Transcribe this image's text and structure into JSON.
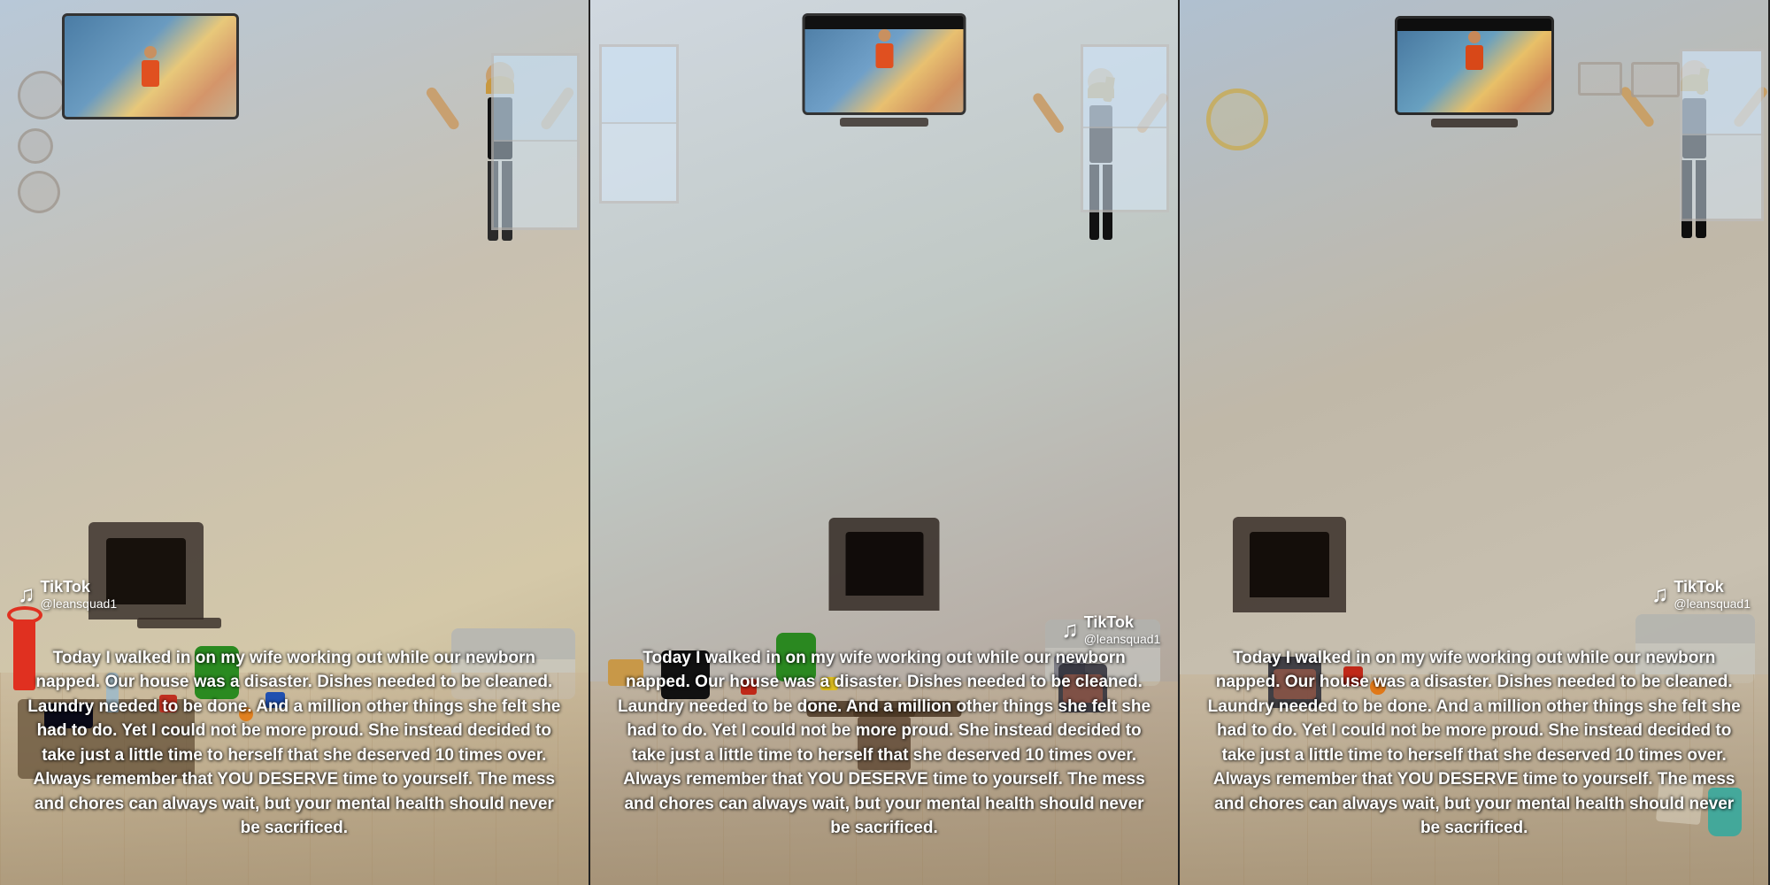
{
  "panels": [
    {
      "id": "panel1",
      "caption": "Today I walked in on my wife working out while our newborn napped. Our house was a disaster. Dishes needed to be cleaned. Laundry needed to be done. And a million other things she felt she had to do. Yet I could not be more proud. She instead decided to take just a little time to herself that she deserved 10 times over. Always remember that YOU DESERVE time to yourself. The mess and chores can always wait, but your mental health should never be sacrificed.",
      "tiktok_logo": "TikTok",
      "handle": "@leansquad1",
      "watermark_position": "bottom-left"
    },
    {
      "id": "panel2",
      "caption": "Today I walked in on my wife working out while our newborn napped. Our house was a disaster. Dishes needed to be cleaned. Laundry needed to be done. And a million other things she felt she had to do. Yet I could not be more proud. She instead decided to take just a little time to herself that she deserved 10 times over. Always remember that YOU DESERVE time to yourself. The mess and chores can always wait, but your mental health should never be sacrificed.",
      "tiktok_logo": "TikTok",
      "handle": "@leansquad1",
      "watermark_position": "bottom-right"
    },
    {
      "id": "panel3",
      "caption": "Today I walked in on my wife working out while our newborn napped. Our house was a disaster. Dishes needed to be cleaned. Laundry needed to be done. And a million other things she felt she had to do. Yet I could not be more proud. She instead decided to take just a little time to herself that she deserved 10 times over. Always remember that YOU DESERVE time to yourself. The mess and chores can always wait, but your mental health should never be sacrificed.",
      "tiktok_logo": "TikTok",
      "handle": "@leansquad1",
      "watermark_position": "bottom-right"
    }
  ]
}
